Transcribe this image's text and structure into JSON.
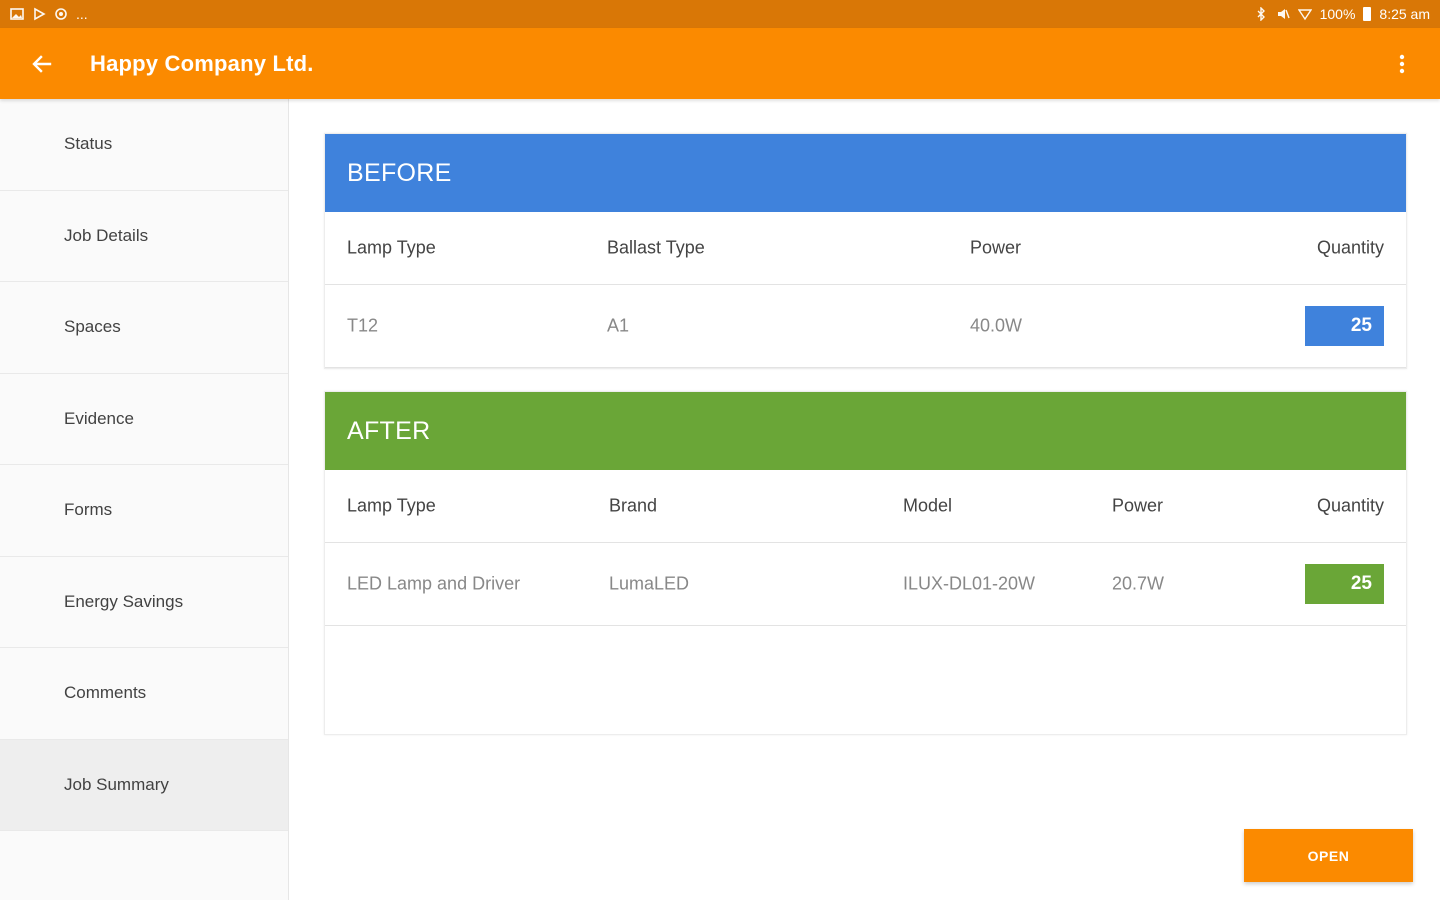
{
  "status_bar": {
    "left_icons": [
      "gallery-icon",
      "play-store-icon",
      "settings-icon"
    ],
    "ellipsis": "...",
    "battery": "100%",
    "time": "8:25 am"
  },
  "app_bar": {
    "title": "Happy Company Ltd."
  },
  "sidebar": {
    "items": [
      {
        "label": "Status"
      },
      {
        "label": "Job Details"
      },
      {
        "label": "Spaces"
      },
      {
        "label": "Evidence"
      },
      {
        "label": "Forms"
      },
      {
        "label": "Energy Savings"
      },
      {
        "label": "Comments"
      },
      {
        "label": "Job Summary",
        "active": true
      }
    ]
  },
  "before": {
    "title": "BEFORE",
    "headers": [
      "Lamp Type",
      "Ballast Type",
      "Power",
      "Quantity"
    ],
    "row": {
      "lamp_type": "T12",
      "ballast_type": "A1",
      "power": "40.0W",
      "quantity": "25"
    }
  },
  "after": {
    "title": "AFTER",
    "headers": [
      "Lamp Type",
      "Brand",
      "Model",
      "Power",
      "Quantity"
    ],
    "row": {
      "lamp_type": "LED Lamp and Driver",
      "brand": "LumaLED",
      "model": "ILUX-DL01-20W",
      "power": "20.7W",
      "quantity": "25"
    }
  },
  "open_button": "OPEN",
  "colors": {
    "status_bar": "#d97706",
    "app_bar": "#fb8a00",
    "before": "#3f82dc",
    "after": "#6aa637"
  }
}
